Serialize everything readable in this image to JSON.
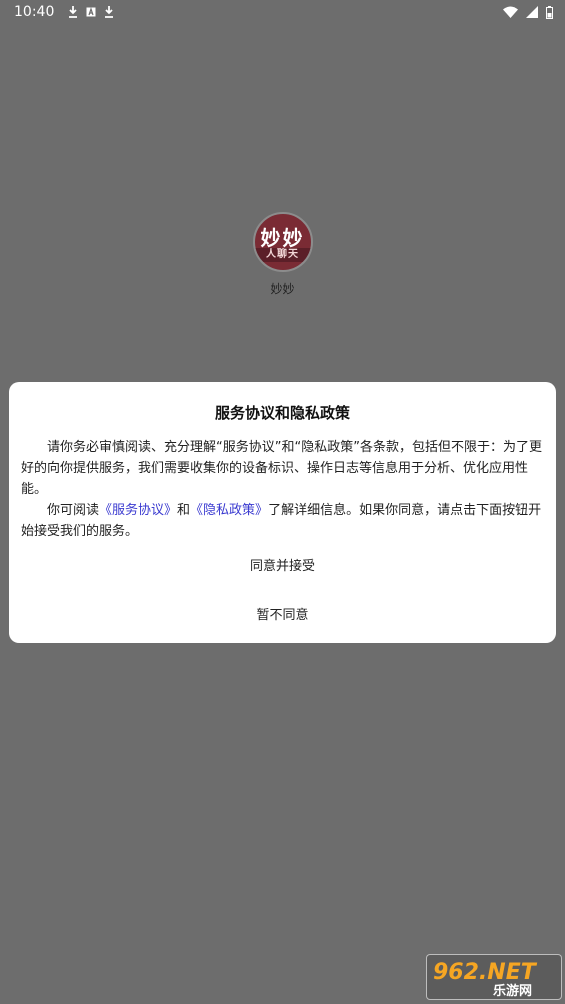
{
  "status_bar": {
    "time": "10:40",
    "left_icons": [
      "download-icon",
      "a-box-icon",
      "download-icon"
    ],
    "right_icons": [
      "wifi-icon",
      "signal-icon",
      "battery-icon"
    ]
  },
  "app": {
    "logo_top_text": "妙妙",
    "logo_band_text": "人聊天",
    "name": "妙妙"
  },
  "dialog": {
    "title": "服务协议和隐私政策",
    "paragraph1": "请你务必审慎阅读、充分理解“服务协议”和“隐私政策”各条款，包括但不限于：为了更好的向你提供服务，我们需要收集你的设备标识、操作日志等信息用于分析、优化应用性能。",
    "p2_prefix": "你可阅读",
    "link_service": "《服务协议》",
    "p2_and": "和",
    "link_privacy": "《隐私政策》",
    "p2_suffix": "了解详细信息。如果你同意，请点击下面按钮开始接受我们的服务。",
    "agree_label": "同意并接受",
    "disagree_label": "暂不同意"
  },
  "watermark": {
    "brand": "962.NET",
    "subtitle": "乐游网"
  },
  "colors": {
    "overlay_bg": "#6d6d6d",
    "link": "#3b3bd0",
    "dialog_bg": "#ffffff"
  }
}
